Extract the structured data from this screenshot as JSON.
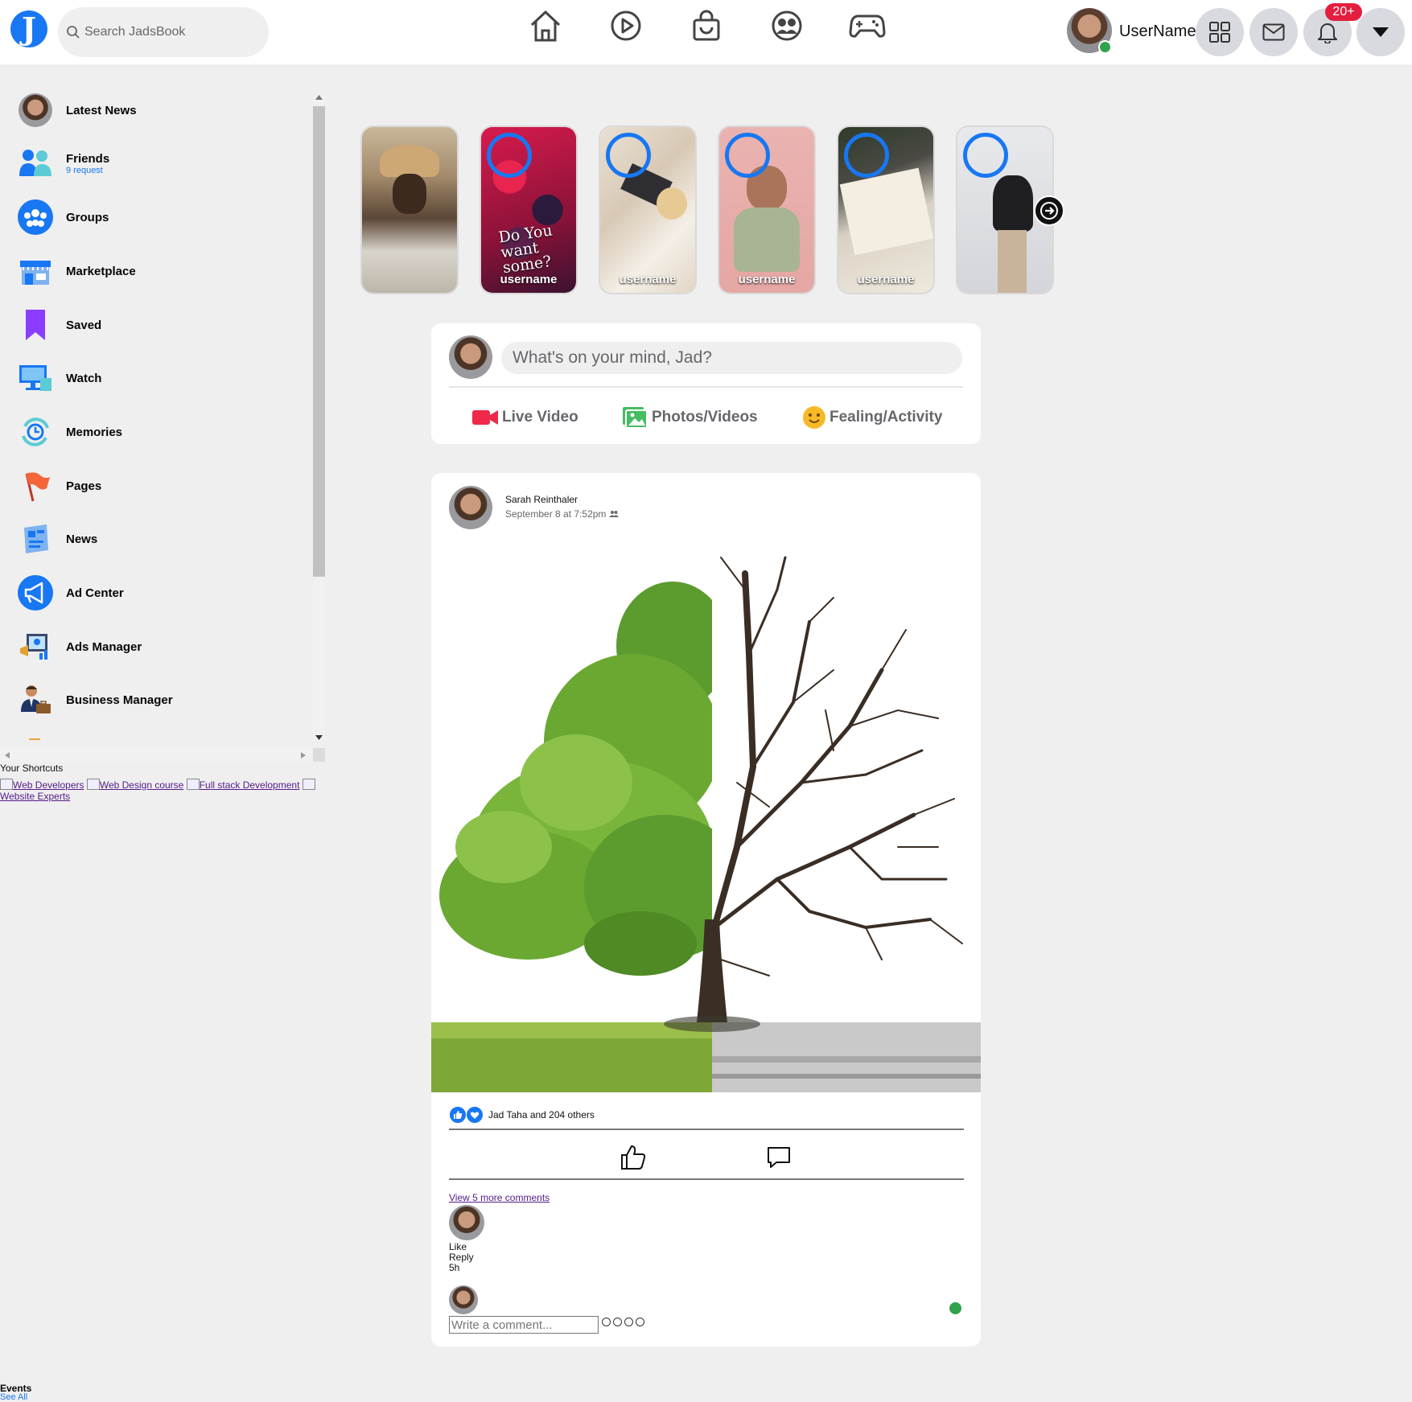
{
  "app": {
    "logo_letter": "J"
  },
  "search": {
    "placeholder": "Search JadsBook"
  },
  "header": {
    "nav_icons": [
      "home-icon",
      "video-play-icon",
      "marketplace-bag-icon",
      "groups-icon",
      "gaming-icon"
    ],
    "username": "UserName",
    "notification_badge": "20+"
  },
  "sidebar": {
    "items": [
      {
        "label": "Latest News",
        "sub": "",
        "icon": "profile-avatar-icon"
      },
      {
        "label": "Friends",
        "sub": "9 request",
        "icon": "friends-icon"
      },
      {
        "label": "Groups",
        "sub": "",
        "icon": "groups-icon"
      },
      {
        "label": "Marketplace",
        "sub": "",
        "icon": "marketplace-icon"
      },
      {
        "label": "Saved",
        "sub": "",
        "icon": "bookmark-icon"
      },
      {
        "label": "Watch",
        "sub": "",
        "icon": "watch-icon"
      },
      {
        "label": "Memories",
        "sub": "",
        "icon": "memories-icon"
      },
      {
        "label": "Pages",
        "sub": "",
        "icon": "flag-icon"
      },
      {
        "label": "News",
        "sub": "",
        "icon": "news-icon"
      },
      {
        "label": "Ad Center",
        "sub": "",
        "icon": "megaphone-icon"
      },
      {
        "label": "Ads Manager",
        "sub": "",
        "icon": "ads-manager-icon"
      },
      {
        "label": "Business Manager",
        "sub": "",
        "icon": "business-manager-icon"
      }
    ],
    "shortcuts_title": "Your Shortcuts",
    "shortcuts": [
      "Web Developers",
      "Web Design course",
      "Full stack Development",
      "Website Experts"
    ],
    "events_title": "Events",
    "events_link": "See All"
  },
  "stories": {
    "items": [
      {
        "name": "",
        "overlay": ""
      },
      {
        "name": "username",
        "overlay": "Do You want some?"
      },
      {
        "name": "username",
        "overlay": ""
      },
      {
        "name": "username",
        "overlay": ""
      },
      {
        "name": "username",
        "overlay": ""
      },
      {
        "name": "",
        "overlay": ""
      }
    ]
  },
  "composer": {
    "placeholder": "What's on your mind, Jad?",
    "actions": [
      "Live Video",
      "Photos/Videos",
      "Fealing/Activity"
    ]
  },
  "post": {
    "author": "Sarah Reinthaler",
    "time": "September 8 at 7:52pm",
    "reactions_text": "Jad Taha and 204 others",
    "view_more": "View 5 more comments",
    "comment_actions": [
      "Like",
      "Reply",
      "5h"
    ],
    "comment_placeholder": "Write a comment..."
  },
  "colors": {
    "brand": "#1877f2",
    "badge": "#e41e3f",
    "online": "#31a24c"
  }
}
